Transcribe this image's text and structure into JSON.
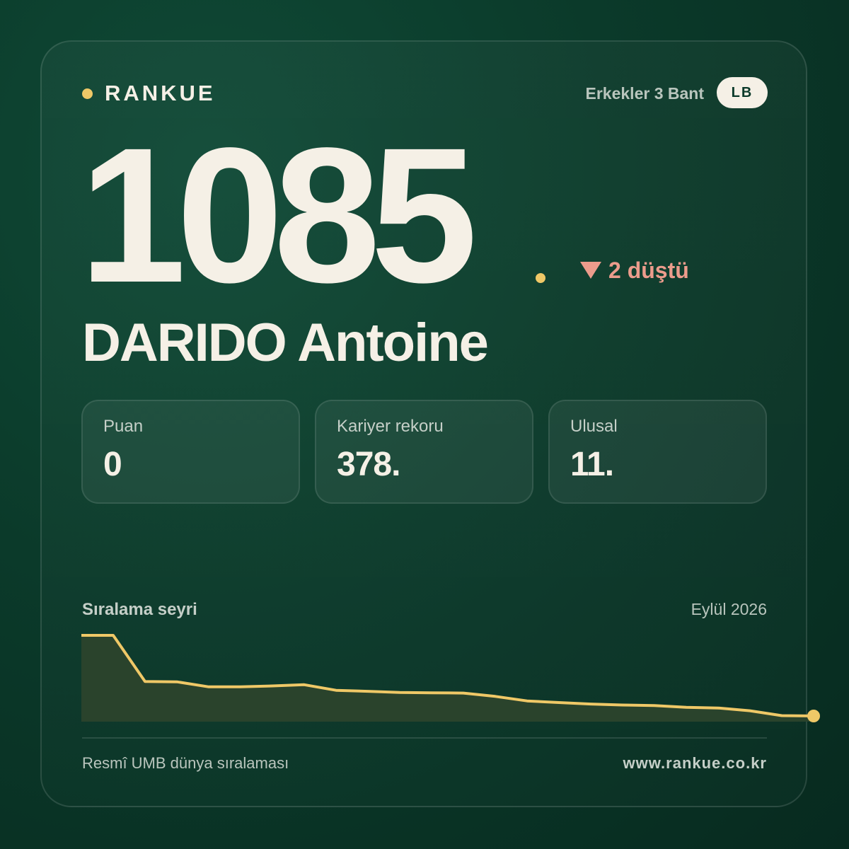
{
  "brand": {
    "name": "RANKUE",
    "dot_color": "#efc867"
  },
  "header": {
    "category": "Erkekler 3 Bant",
    "badge": "LB"
  },
  "rank": {
    "value": "1085",
    "change_label": "2 düştü",
    "change_icon": "down-triangle-icon",
    "change_color": "#ec9c8c"
  },
  "player": {
    "name": "DARIDO Antoine"
  },
  "stats": [
    {
      "label": "Puan",
      "value": "0"
    },
    {
      "label": "Kariyer rekoru",
      "value": "378."
    },
    {
      "label": "Ulusal",
      "value": "11."
    }
  ],
  "trend": {
    "title": "Sıralama seyri",
    "date": "Eylül 2026"
  },
  "chart_data": {
    "type": "area",
    "line_color": "#efc867",
    "fill_color": "#2a432c",
    "values": [
      378,
      378,
      660,
      662,
      693,
      693,
      687,
      680,
      714,
      720,
      727,
      729,
      731,
      751,
      779,
      789,
      798,
      804,
      807,
      818,
      822,
      839,
      869,
      871
    ]
  },
  "footer": {
    "source": "Resmî UMB dünya sıralaması",
    "url": "www.rankue.co.kr"
  }
}
